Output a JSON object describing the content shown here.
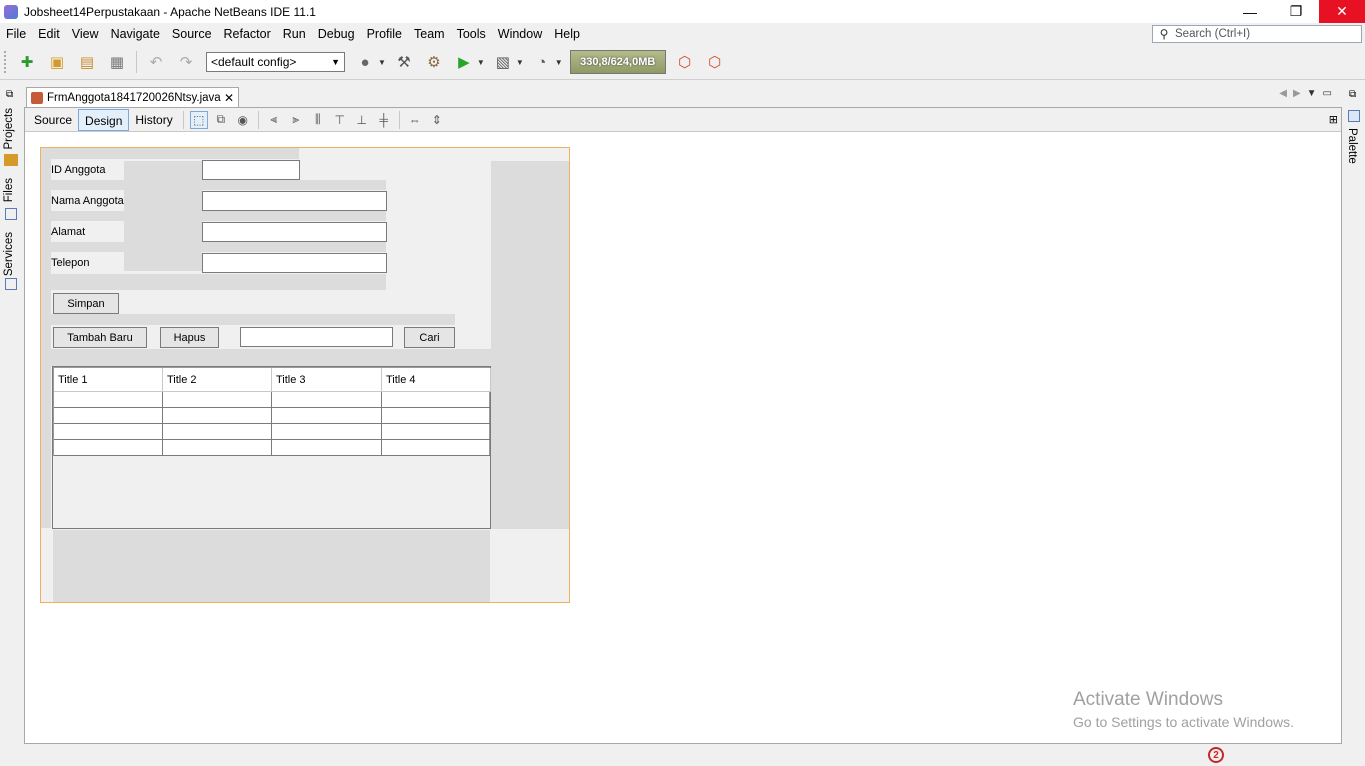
{
  "window": {
    "title": "Jobsheet14Perpustakaan - Apache NetBeans IDE 11.1"
  },
  "menu": [
    "File",
    "Edit",
    "View",
    "Navigate",
    "Source",
    "Refactor",
    "Run",
    "Debug",
    "Profile",
    "Team",
    "Tools",
    "Window",
    "Help"
  ],
  "search": {
    "placeholder": "Search (Ctrl+I)"
  },
  "toolbar": {
    "config": "<default config>",
    "memory": "330,8/624,0MB"
  },
  "sidebar": {
    "left": [
      "Projects",
      "Files",
      "Services"
    ],
    "right": "Palette"
  },
  "editor": {
    "file_tab": "FrmAnggota1841720026Ntsy.java",
    "views": [
      "Source",
      "Design",
      "History"
    ]
  },
  "form": {
    "labels": {
      "id": "ID Anggota",
      "nama": "Nama Anggota",
      "alamat": "Alamat",
      "telepon": "Telepon"
    },
    "buttons": {
      "simpan": "Simpan",
      "tambah": "Tambah Baru",
      "hapus": "Hapus",
      "cari": "Cari"
    },
    "table": {
      "headers": [
        "Title 1",
        "Title 2",
        "Title 3",
        "Title 4"
      ]
    }
  },
  "watermark": {
    "title": "Activate Windows",
    "subtitle": "Go to Settings to activate Windows."
  },
  "status": {
    "notifications": "2"
  }
}
